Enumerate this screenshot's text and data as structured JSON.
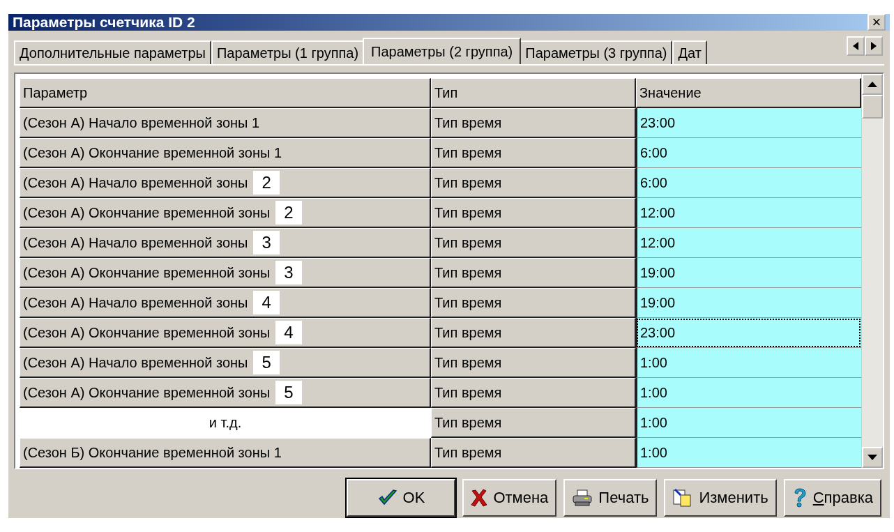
{
  "window": {
    "title": "Параметры счетчика ID 2",
    "close": "×"
  },
  "tabs": [
    {
      "label": "Дополнительные параметры",
      "selected": false
    },
    {
      "label": "Параметры (1 группа)",
      "selected": false
    },
    {
      "label": "Параметры (2 группа)",
      "selected": true
    },
    {
      "label": "Параметры (3 группа)",
      "selected": false
    },
    {
      "label": "Дат",
      "selected": false
    }
  ],
  "table": {
    "columns": [
      "Параметр",
      "Тип",
      "Значение"
    ],
    "rows": [
      {
        "kind": "param",
        "parameter": "(Сезон А) Начало временной зоны 1",
        "type": "Тип время",
        "value": "23:00",
        "focused": false
      },
      {
        "kind": "param",
        "parameter": "(Сезон А) Окончание временной зоны 1",
        "type": "Тип время",
        "value": "6:00",
        "focused": false
      },
      {
        "kind": "param",
        "parameter": "(Сезон А) Начало временной зоны",
        "zone": "2",
        "type": "Тип время",
        "value": "6:00",
        "focused": false
      },
      {
        "kind": "param",
        "parameter": "(Сезон А) Окончание временной зоны",
        "zone": "2",
        "type": "Тип время",
        "value": "12:00",
        "focused": false
      },
      {
        "kind": "param",
        "parameter": "(Сезон А) Начало временной зоны",
        "zone": "3",
        "type": "Тип время",
        "value": "12:00",
        "focused": false
      },
      {
        "kind": "param",
        "parameter": "(Сезон А) Окончание временной зоны",
        "zone": "3",
        "type": "Тип время",
        "value": "19:00",
        "focused": false
      },
      {
        "kind": "param",
        "parameter": "(Сезон А) Начало временной зоны",
        "zone": "4",
        "type": "Тип время",
        "value": "19:00",
        "focused": false
      },
      {
        "kind": "param",
        "parameter": "(Сезон А) Окончание временной зоны",
        "zone": "4",
        "type": "Тип время",
        "value": "23:00",
        "focused": true
      },
      {
        "kind": "param",
        "parameter": "(Сезон А) Начало временной зоны",
        "zone": "5",
        "type": "Тип время",
        "value": "1:00",
        "focused": false
      },
      {
        "kind": "param",
        "parameter": "(Сезон А) Окончание временной зоны",
        "zone": "5",
        "type": "Тип время",
        "value": "1:00",
        "focused": false
      },
      {
        "kind": "note",
        "parameter": "и т.д.",
        "type": "Тип время",
        "value": "1:00",
        "focused": false
      },
      {
        "kind": "param",
        "parameter": "(Сезон Б) Окончание временной зоны 1",
        "type": "Тип время",
        "value": "1:00",
        "focused": false
      }
    ]
  },
  "buttons": [
    {
      "kind": "ok",
      "label": "OK",
      "underline_first": false
    },
    {
      "kind": "cancel",
      "label": "Отмена",
      "underline_first": false
    },
    {
      "kind": "print",
      "label": "Печать",
      "underline_first": false
    },
    {
      "kind": "edit",
      "label": "Изменить",
      "underline_first": false
    },
    {
      "kind": "help",
      "label": "Справка",
      "underline_first": true
    }
  ]
}
